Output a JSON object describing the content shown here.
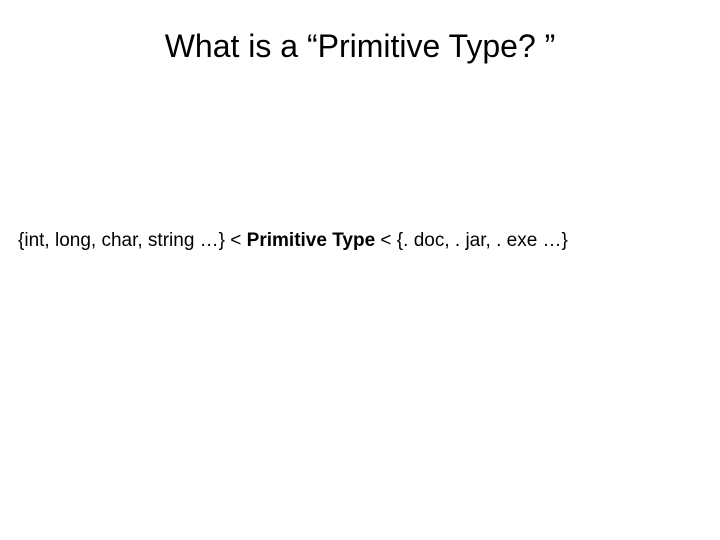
{
  "slide": {
    "title": "What is a “Primitive Type? ”",
    "body": {
      "left_set": "{int, long, char, string …} < ",
      "emphasis": "Primitive Type",
      "right_set": " < {. doc, . jar, . exe …}"
    }
  }
}
